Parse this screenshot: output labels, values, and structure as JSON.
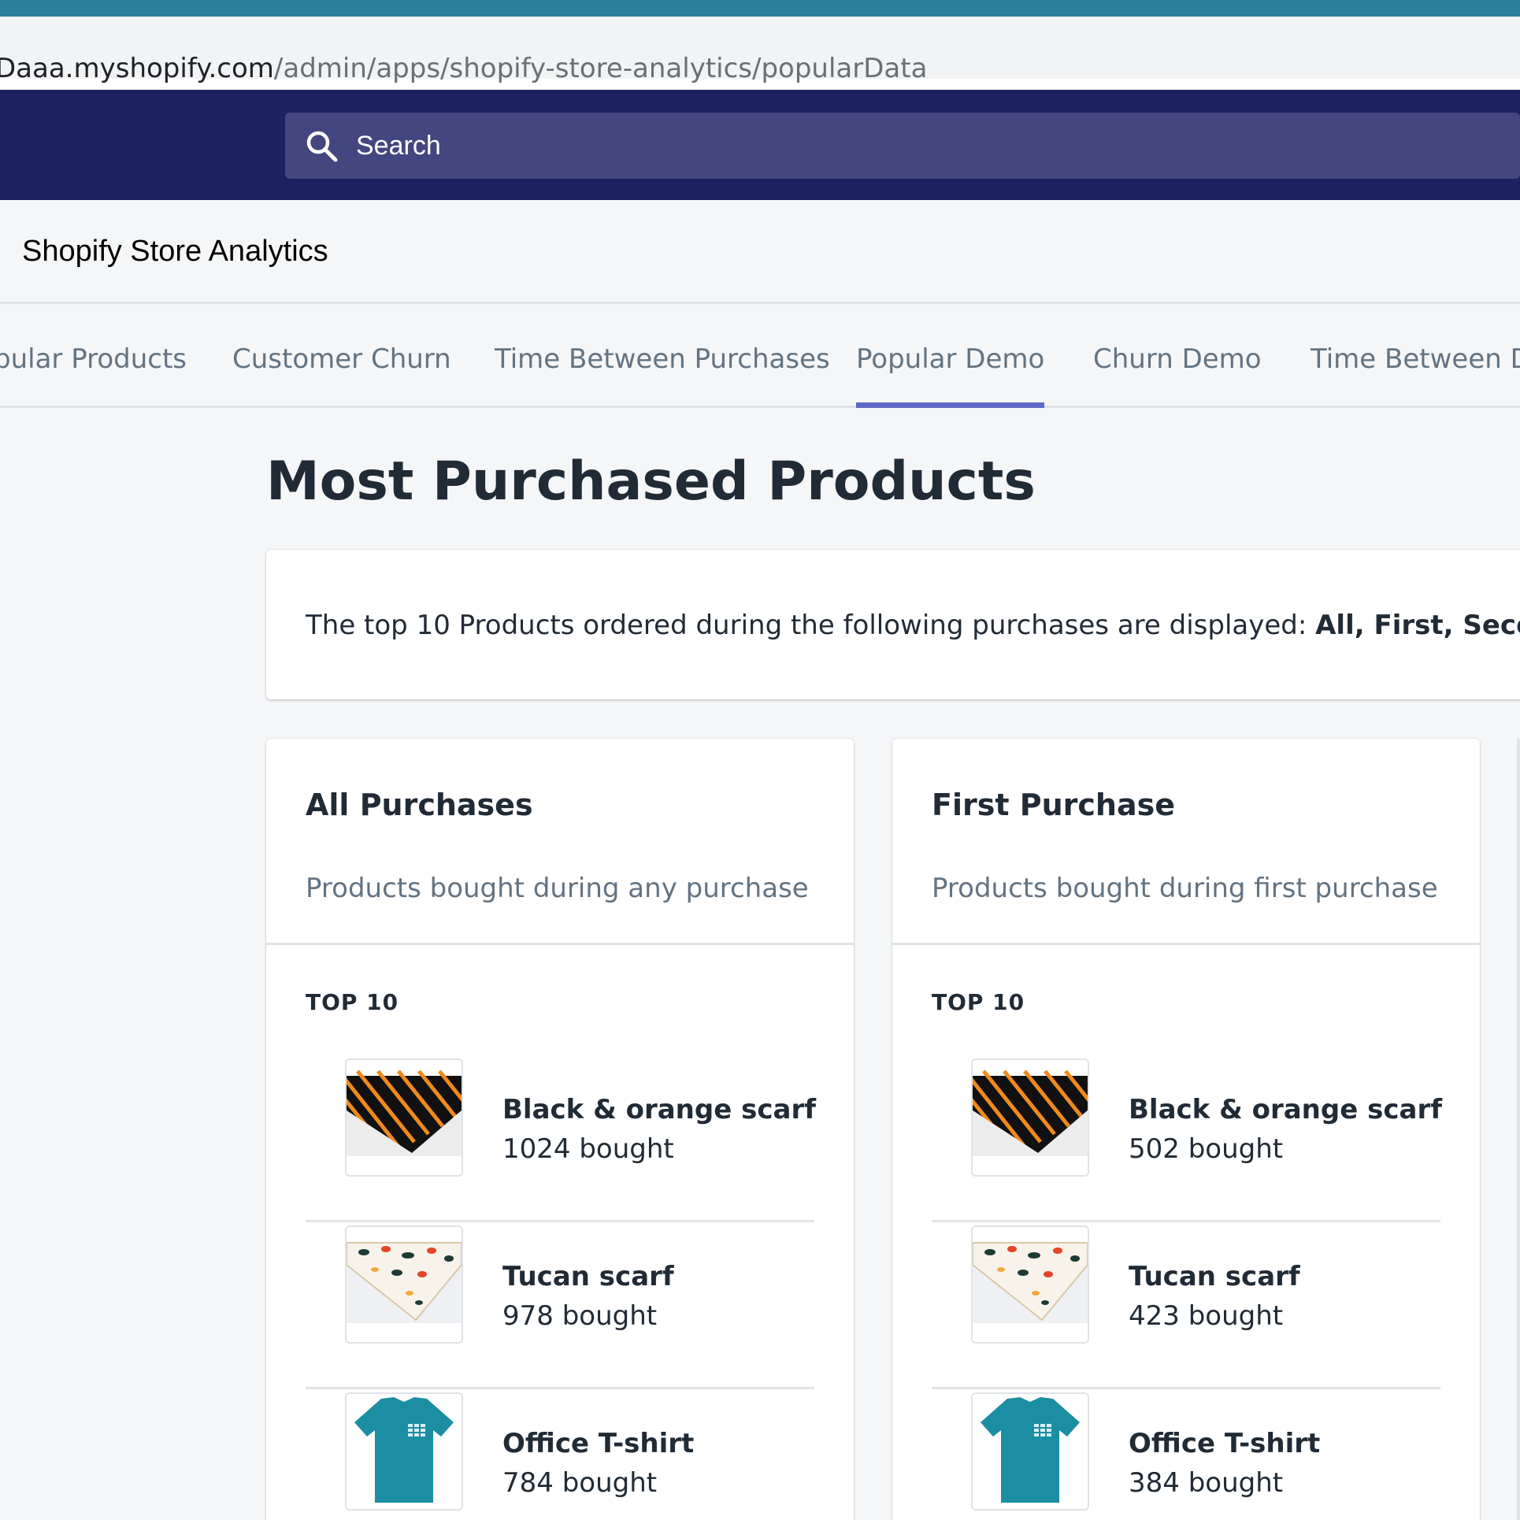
{
  "browser": {
    "url_host": "Daaa.myshopify.com",
    "url_path": "/admin/apps/shopify-store-analytics/popularData"
  },
  "topbar": {
    "search_placeholder": "Search",
    "search_icon": "search-icon"
  },
  "app": {
    "title": "Shopify Store Analytics"
  },
  "tabs": [
    {
      "label": "pular Products",
      "active": false
    },
    {
      "label": "Customer Churn",
      "active": false
    },
    {
      "label": "Time Between Purchases",
      "active": false
    },
    {
      "label": "Popular Demo",
      "active": true
    },
    {
      "label": "Churn Demo",
      "active": false
    },
    {
      "label": "Time Between De",
      "active": false
    }
  ],
  "page": {
    "title": "Most Purchased Products",
    "info_prefix": "The top 10 Products ordered during the following purchases are displayed: ",
    "info_bold": "All, First, Second"
  },
  "cards": [
    {
      "title": "All Purchases",
      "subtitle": "Products bought during any purchase",
      "top_label": "TOP 10",
      "products": [
        {
          "name": "Black & orange scarf",
          "count": "1024 bought",
          "image": "black-orange-scarf"
        },
        {
          "name": "Tucan scarf",
          "count": "978 bought",
          "image": "tucan-scarf"
        },
        {
          "name": "Office T-shirt",
          "count": "784 bought",
          "image": "office-tshirt"
        }
      ]
    },
    {
      "title": "First Purchase",
      "subtitle": "Products bought during first purchase",
      "top_label": "TOP 10",
      "products": [
        {
          "name": "Black & orange scarf",
          "count": "502 bought",
          "image": "black-orange-scarf"
        },
        {
          "name": "Tucan scarf",
          "count": "423 bought",
          "image": "tucan-scarf"
        },
        {
          "name": "Office T-shirt",
          "count": "384 bought",
          "image": "office-tshirt"
        }
      ]
    }
  ],
  "colors": {
    "topbar": "#1c2260",
    "search": "#43467f",
    "accent": "#5c6ac4",
    "browser_strip": "#2e7f9b"
  }
}
